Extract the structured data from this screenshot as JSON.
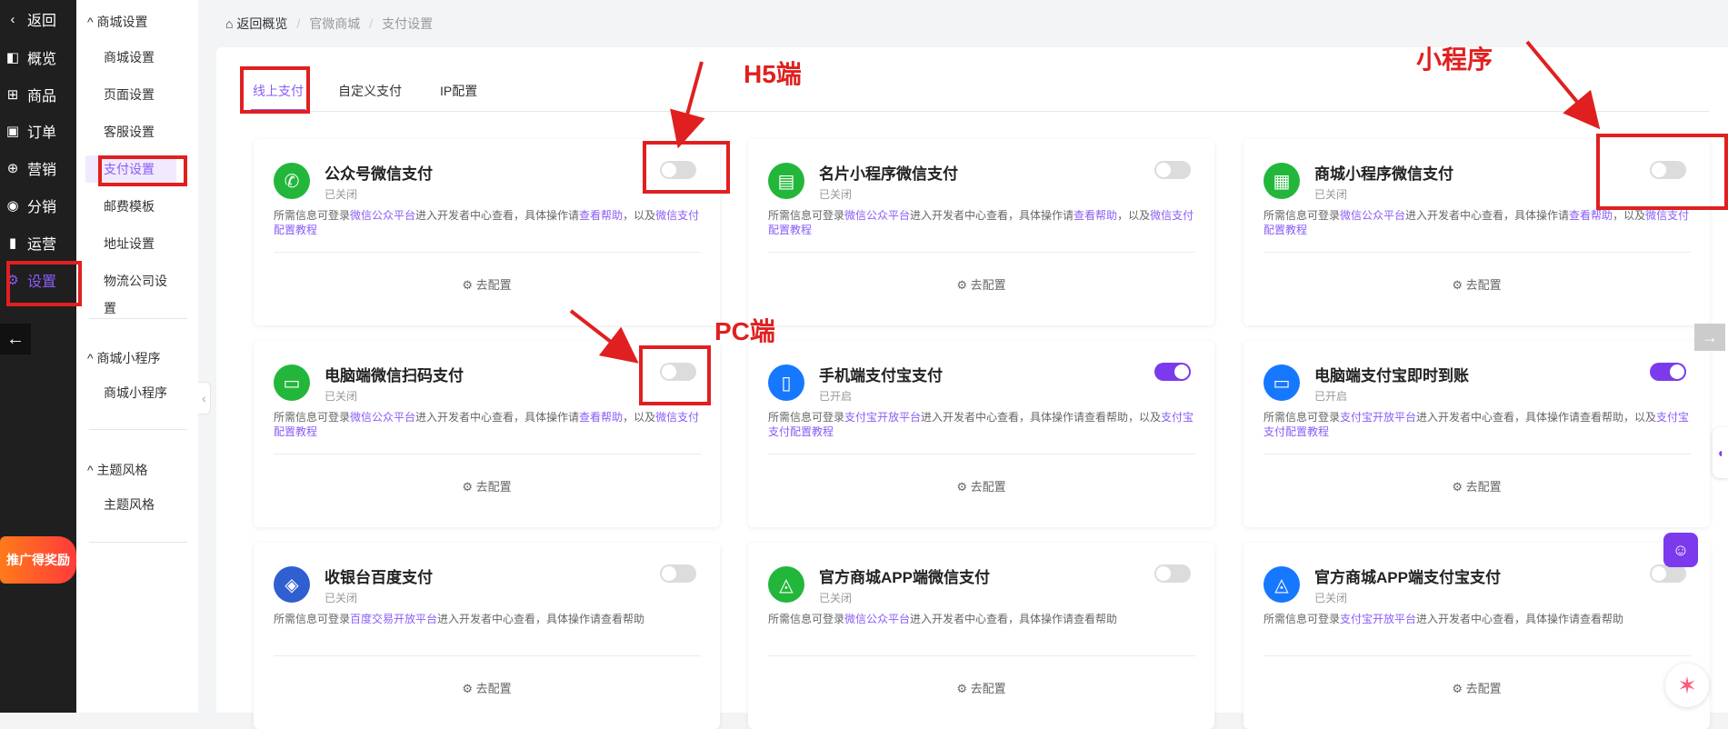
{
  "nav": {
    "items": [
      {
        "icon": "chevron-left-icon",
        "glyph": "‹",
        "label": "返回"
      },
      {
        "icon": "overview-icon",
        "glyph": "◧",
        "label": "概览"
      },
      {
        "icon": "goods-icon",
        "glyph": "⊞",
        "label": "商品"
      },
      {
        "icon": "order-icon",
        "glyph": "▣",
        "label": "订单"
      },
      {
        "icon": "marketing-icon",
        "glyph": "⊕",
        "label": "营销"
      },
      {
        "icon": "distribution-icon",
        "glyph": "◉",
        "label": "分销"
      },
      {
        "icon": "operation-icon",
        "glyph": "▮",
        "label": "运营"
      },
      {
        "icon": "settings-icon",
        "glyph": "⚙",
        "label": "设置"
      }
    ],
    "promo_text": "推广得奖励"
  },
  "sub": {
    "group1": "商城设置",
    "group1_items": [
      "商城设置",
      "页面设置",
      "客服设置",
      "支付设置",
      "邮费模板",
      "地址设置",
      "物流公司设置"
    ],
    "group2": "商城小程序",
    "group2_items": [
      "商城小程序"
    ],
    "group3": "主题风格",
    "group3_items": [
      "主题风格"
    ]
  },
  "breadcrumb": {
    "home": "返回概览",
    "level1": "官微商城",
    "level2": "支付设置",
    "sep": "/"
  },
  "tabs": [
    "线上支付",
    "自定义支付",
    "IP配置"
  ],
  "cards": [
    {
      "title": "公众号微信支付",
      "status": "已关闭",
      "on": false,
      "desc_pre": "所需信息可登录",
      "link1": "微信公众平台",
      "desc_mid": "进入开发者中心查看，具体操作请",
      "link2": "查看帮助",
      "desc_mid2": "，以及",
      "link3": "微信支付配置教程",
      "cfg": "去配置",
      "logo_color": "#22b73a",
      "logo_glyph": "✆"
    },
    {
      "title": "名片小程序微信支付",
      "status": "已关闭",
      "on": false,
      "desc_pre": "所需信息可登录",
      "link1": "微信公众平台",
      "desc_mid": "进入开发者中心查看，具体操作请",
      "link2": "查看帮助",
      "desc_mid2": "，以及",
      "link3": "微信支付配置教程",
      "cfg": "去配置",
      "logo_color": "#22b73a",
      "logo_glyph": "▤"
    },
    {
      "title": "商城小程序微信支付",
      "status": "已关闭",
      "on": false,
      "desc_pre": "所需信息可登录",
      "link1": "微信公众平台",
      "desc_mid": "进入开发者中心查看，具体操作请",
      "link2": "查看帮助",
      "desc_mid2": "，以及",
      "link3": "微信支付配置教程",
      "cfg": "去配置",
      "logo_color": "#22b73a",
      "logo_glyph": "▦"
    },
    {
      "title": "电脑端微信扫码支付",
      "status": "已关闭",
      "on": false,
      "desc_pre": "所需信息可登录",
      "link1": "微信公众平台",
      "desc_mid": "进入开发者中心查看，具体操作请",
      "link2": "查看帮助",
      "desc_mid2": "，以及",
      "link3": "微信支付配置教程",
      "cfg": "去配置",
      "logo_color": "#22b73a",
      "logo_glyph": "▭"
    },
    {
      "title": "手机端支付宝支付",
      "status": "已开启",
      "on": true,
      "desc_pre": "所需信息可登录",
      "link1": "支付宝开放平台",
      "desc_mid": "进入开发者中心查看，具体操作请查看帮助，以及",
      "link2": "",
      "desc_mid2": "",
      "link3": "支付宝支付配置教程",
      "cfg": "去配置",
      "logo_color": "#1677ff",
      "logo_glyph": "▯"
    },
    {
      "title": "电脑端支付宝即时到账",
      "status": "已开启",
      "on": true,
      "desc_pre": "所需信息可登录",
      "link1": "支付宝开放平台",
      "desc_mid": "进入开发者中心查看，具体操作请查看帮助，以及",
      "link2": "",
      "desc_mid2": "",
      "link3": "支付宝支付配置教程",
      "cfg": "去配置",
      "logo_color": "#1677ff",
      "logo_glyph": "▭"
    },
    {
      "title": "收银台百度支付",
      "status": "已关闭",
      "on": false,
      "desc_pre": "所需信息可登录",
      "link1": "百度交易开放平台",
      "desc_mid": "进入开发者中心查看，具体操作请查看帮助",
      "link2": "",
      "desc_mid2": "",
      "link3": "",
      "cfg": "去配置",
      "logo_color": "#2f5fd0",
      "logo_glyph": "◈"
    },
    {
      "title": "官方商城APP端微信支付",
      "status": "已关闭",
      "on": false,
      "desc_pre": "所需信息可登录",
      "link1": "微信公众平台",
      "desc_mid": "进入开发者中心查看，具体操作请查看帮助",
      "link2": "",
      "desc_mid2": "",
      "link3": "",
      "cfg": "去配置",
      "logo_color": "#22b73a",
      "logo_glyph": "◬"
    },
    {
      "title": "官方商城APP端支付宝支付",
      "status": "已关闭",
      "on": false,
      "desc_pre": "所需信息可登录",
      "link1": "支付宝开放平台",
      "desc_mid": "进入开发者中心查看，具体操作请查看帮助",
      "link2": "",
      "desc_mid2": "",
      "link3": "",
      "cfg": "去配置",
      "logo_color": "#1677ff",
      "logo_glyph": "◬"
    }
  ],
  "annotations": {
    "h5": "H5端",
    "miniprogram": "小程序",
    "pc": "PC端"
  },
  "colors": {
    "accent": "#8a5cf6",
    "annotation": "#e02020",
    "toggle_on": "#7c3aed"
  }
}
